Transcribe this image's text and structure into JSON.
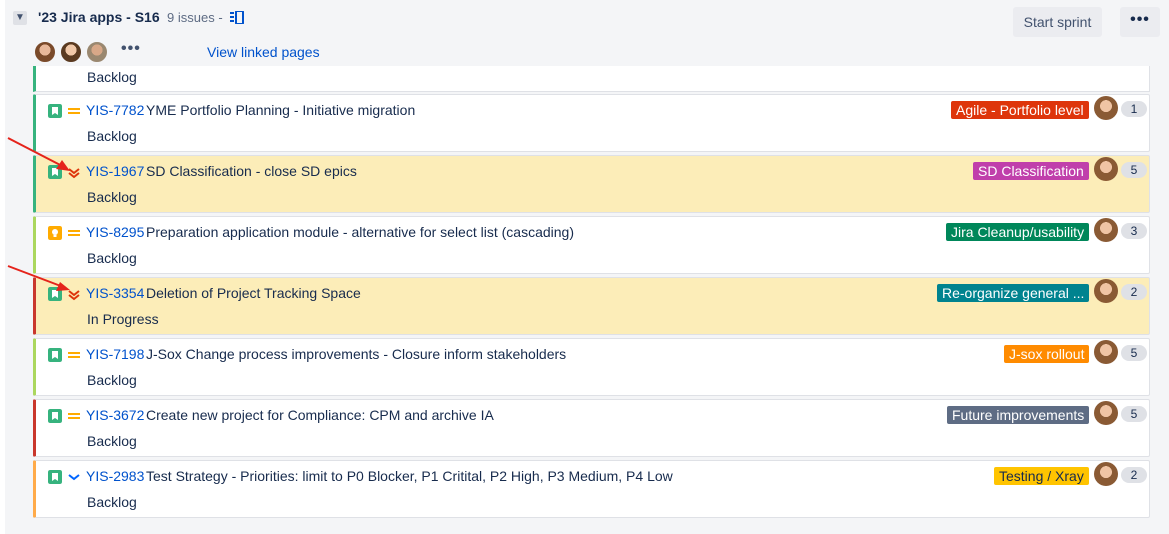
{
  "sprint": {
    "name": "'23 Jira apps - S16",
    "issue_count": "9 issues",
    "separator": "-",
    "start_label": "Start sprint",
    "more_label": "•••",
    "linked_pages": "View linked pages",
    "avatars_more": "•••"
  },
  "partial": {
    "status": "Backlog"
  },
  "issues": [
    {
      "key": "YIS-7782",
      "summary": "YME Portfolio Planning - Initiative migration",
      "status": "Backlog",
      "epic": "Agile - Portfolio level",
      "epic_color": "#de350b",
      "points": "1",
      "type": "story",
      "priority": "medium",
      "flagged": false,
      "edge_color": "#36b37e"
    },
    {
      "key": "YIS-1967",
      "summary": "SD Classification - close SD epics",
      "status": "Backlog",
      "epic": "SD Classification",
      "epic_color": "#c03fab",
      "points": "5",
      "type": "story",
      "priority": "highest",
      "flagged": true,
      "edge_color": "#36b37e"
    },
    {
      "key": "YIS-8295",
      "summary": "Preparation application module - alternative for select list (cascading)",
      "status": "Backlog",
      "epic": "Jira Cleanup/usability",
      "epic_color": "#00875a",
      "points": "3",
      "type": "improvement",
      "priority": "medium",
      "flagged": false,
      "edge_color": "#abd75e"
    },
    {
      "key": "YIS-3354",
      "summary": "Deletion of Project Tracking Space",
      "status": "In Progress",
      "epic": "Re-organize general ...",
      "epic_color": "#00838f",
      "points": "2",
      "type": "story",
      "priority": "highest",
      "flagged": true,
      "edge_color": "#c9372c"
    },
    {
      "key": "YIS-7198",
      "summary": "J-Sox Change process improvements - Closure inform stakeholders",
      "status": "Backlog",
      "epic": "J-sox rollout",
      "epic_color": "#ff8b00",
      "points": "5",
      "type": "story",
      "priority": "medium",
      "flagged": false,
      "edge_color": "#abd75e"
    },
    {
      "key": "YIS-3672",
      "summary": "Create new project for Compliance: CPM and archive IA",
      "status": "Backlog",
      "epic": "Future improvements",
      "epic_color": "#5e6c84",
      "points": "5",
      "type": "story",
      "priority": "medium",
      "flagged": false,
      "edge_color": "#c9372c"
    },
    {
      "key": "YIS-2983",
      "summary": "Test Strategy - Priorities: limit to P0 Blocker, P1 Critital, P2 High, P3 Medium, P4 Low",
      "status": "Backlog",
      "epic": "Testing / Xray",
      "epic_color": "#ffc400",
      "points": "2",
      "type": "story",
      "priority": "low",
      "flagged": false,
      "edge_color": "#ffab4a"
    }
  ],
  "colors": {
    "story": "#36b37e",
    "improvement": "#ffab00",
    "priority_medium": "#ffab00",
    "priority_highest": "#de350b",
    "priority_low": "#0065ff",
    "arrow": "#e5231b"
  }
}
